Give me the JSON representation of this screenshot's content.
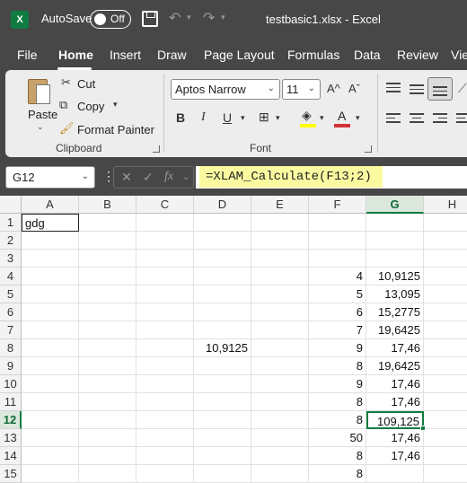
{
  "titlebar": {
    "autosave_label": "AutoSave",
    "autosave_state": "Off",
    "file_title": "testbasic1.xlsx - Excel",
    "app_logo": "X"
  },
  "tabs": [
    "File",
    "Home",
    "Insert",
    "Draw",
    "Page Layout",
    "Formulas",
    "Data",
    "Review",
    "Vie"
  ],
  "active_tab": "Home",
  "ribbon": {
    "clipboard": {
      "paste": "Paste",
      "cut": "Cut",
      "copy": "Copy",
      "format_painter": "Format Painter",
      "group_label": "Clipboard"
    },
    "font": {
      "font_name": "Aptos Narrow",
      "font_size": "11",
      "grow": "A^",
      "shrink": "Aˇ",
      "bold": "B",
      "italic": "I",
      "underline": "U",
      "font_color": "A",
      "group_label": "Font"
    }
  },
  "formula_bar": {
    "name_box": "G12",
    "fx": "fx",
    "formula": "=XLAM_Calculate(F13;2)"
  },
  "grid": {
    "columns": [
      "A",
      "B",
      "C",
      "D",
      "E",
      "F",
      "G",
      "H"
    ],
    "selected_column": "G",
    "rows": [
      "1",
      "2",
      "3",
      "4",
      "5",
      "6",
      "7",
      "8",
      "9",
      "10",
      "11",
      "12",
      "13",
      "14",
      "15"
    ],
    "selected_row": "12",
    "cells": {
      "A1": "gdg",
      "D8": "10,9125",
      "F4": "4",
      "G4": "10,9125",
      "F5": "5",
      "G5": "13,095",
      "F6": "6",
      "G6": "15,2775",
      "F7": "7",
      "G7": "19,6425",
      "F8": "9",
      "G8": "17,46",
      "F9": "8",
      "G9": "19,6425",
      "F10": "9",
      "G10": "17,46",
      "F11": "8",
      "G11": "17,46",
      "F12": "8",
      "G12": "109,125",
      "F13": "50",
      "G13": "17,46",
      "F14": "8",
      "G14": "17,46",
      "F15": "8"
    }
  },
  "colors": {
    "chrome": "#474747",
    "ribbon": "#ededed",
    "excel_green": "#107c41",
    "formula_highlight": "#fbfaa0",
    "font_color_bar": "#d13438",
    "highlight_bar": "#ffff00"
  }
}
